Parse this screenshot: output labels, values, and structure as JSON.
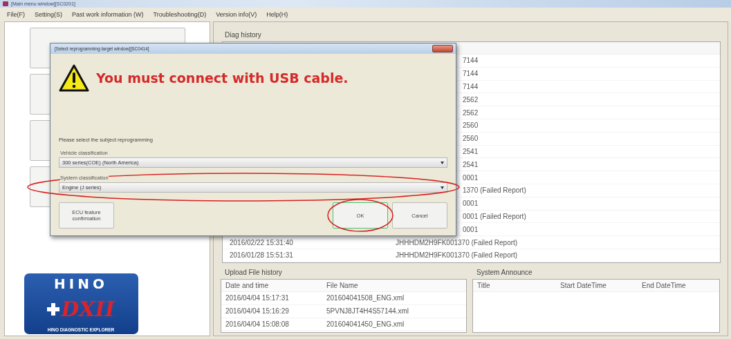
{
  "window": {
    "title": "[Main menu window][SC0201]"
  },
  "menu": [
    "File(F)",
    "Setting(S)",
    "Past work information (W)",
    "Troubleshooting(D)",
    "Version info(V)",
    "Help(H)"
  ],
  "logo": {
    "brand": "HINO",
    "product": "DXII",
    "tagline": "HINO DIAGNOSTIC EXPLORER"
  },
  "diag_history": {
    "title": "Diag history",
    "rows": [
      {
        "vin": "7144"
      },
      {
        "vin": "7144"
      },
      {
        "vin": "7144"
      },
      {
        "vin": "2562"
      },
      {
        "vin": "2562"
      },
      {
        "vin": "2560"
      },
      {
        "vin": "2560"
      },
      {
        "vin": "2541"
      },
      {
        "vin": "2541"
      },
      {
        "vin": "0001"
      },
      {
        "vin": "1370 (Failed Report)"
      },
      {
        "vin": "0001"
      },
      {
        "vin": "0001 (Failed Report)"
      },
      {
        "vin": "0001"
      },
      {
        "date": "2016/02/22 15:31:40",
        "vin": "JHHHDM2H9FK001370 (Failed Report)"
      },
      {
        "date": "2016/01/28 15:51:31",
        "vin": "JHHHDM2H9FK001370 (Failed Report)"
      }
    ]
  },
  "upload_file_history": {
    "title": "Upload File history",
    "columns": [
      "Date and time",
      "File Name"
    ],
    "rows": [
      [
        "2016/04/04 15:17:31",
        "201604041508_ENG.xml"
      ],
      [
        "2016/04/04 15:16:29",
        "5PVNJ8JT4H4S57144.xml"
      ],
      [
        "2016/04/04 15:08:08",
        "201604041450_ENG.xml"
      ]
    ]
  },
  "system_announce": {
    "title": "System Announce",
    "columns": [
      "Title",
      "Start DateTime",
      "End DateTime"
    ]
  },
  "dialog": {
    "title": "[Select reprogramming target window][SC0414]",
    "message": "You must connect with USB cable.",
    "prompt": "Please select the subject reprogramming",
    "fields": [
      {
        "label": "Vehicle classification",
        "value": "300 series(COE) (North America)",
        "highlighted": false
      },
      {
        "label": "System classification",
        "value": "Engine (J series)",
        "highlighted": true
      }
    ],
    "buttons": [
      {
        "label": "ECU feature confirmation",
        "focused": false,
        "highlighted": false
      },
      {
        "label": "OK",
        "focused": true,
        "highlighted": true
      },
      {
        "label": "Cancel",
        "focused": false,
        "highlighted": false
      }
    ]
  }
}
